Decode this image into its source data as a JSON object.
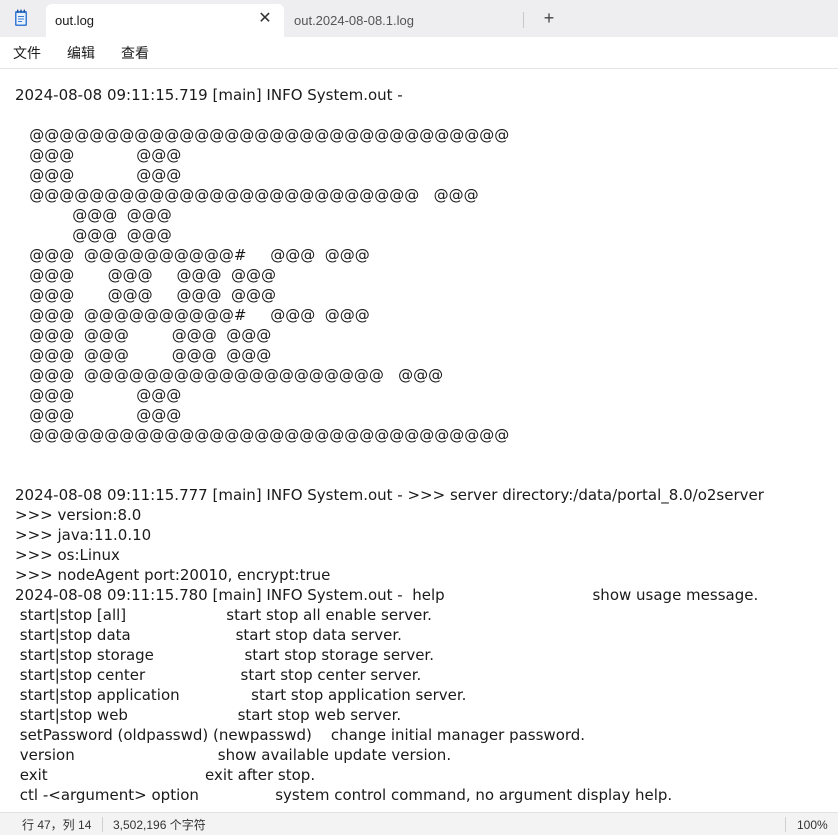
{
  "tabs": [
    {
      "label": "out.log",
      "active": true
    },
    {
      "label": "out.2024-08-08.1.log",
      "active": false
    }
  ],
  "icons": {
    "app": "notepad-icon",
    "close": "close-icon",
    "new_tab": "plus-icon"
  },
  "glyphs": {
    "close": "✕",
    "new_tab": "+"
  },
  "menu": {
    "file": "文件",
    "edit": "编辑",
    "view": "查看"
  },
  "editor": {
    "content": "2024-08-08 09:11:15.719 [main] INFO System.out - \n\n   @@@@@@@@@@@@@@@@@@@@@@@@@@@@@@@@\n   @@@             @@@\n   @@@             @@@\n   @@@@@@@@@@@@@@@@@@@@@@@@@@   @@@\n            @@@  @@@\n            @@@  @@@\n   @@@  @@@@@@@@@@#     @@@  @@@\n   @@@       @@@     @@@  @@@\n   @@@       @@@     @@@  @@@\n   @@@  @@@@@@@@@@#     @@@  @@@\n   @@@  @@@         @@@  @@@\n   @@@  @@@         @@@  @@@\n   @@@  @@@@@@@@@@@@@@@@@@@@   @@@\n   @@@             @@@\n   @@@             @@@\n   @@@@@@@@@@@@@@@@@@@@@@@@@@@@@@@@\n\n\n2024-08-08 09:11:15.777 [main] INFO System.out - >>> server directory:/data/portal_8.0/o2server\n>>> version:8.0\n>>> java:11.0.10\n>>> os:Linux\n>>> nodeAgent port:20010, encrypt:true\n2024-08-08 09:11:15.780 [main] INFO System.out -  help                               show usage message.\n start|stop [all]                     start stop all enable server.\n start|stop data                      start stop data server.\n start|stop storage                   start stop storage server.\n start|stop center                    start stop center server.\n start|stop application               start stop application server.\n start|stop web                       start stop web server.\n setPassword (oldpasswd) (newpasswd)    change initial manager password.\n version                              show available update version.\n exit                                 exit after stop.\n ctl -<argument> option                system control command, no argument display help."
  },
  "status": {
    "position": "行 47，列 14",
    "char_count": "3,502,196 个字符",
    "zoom": "100%"
  }
}
